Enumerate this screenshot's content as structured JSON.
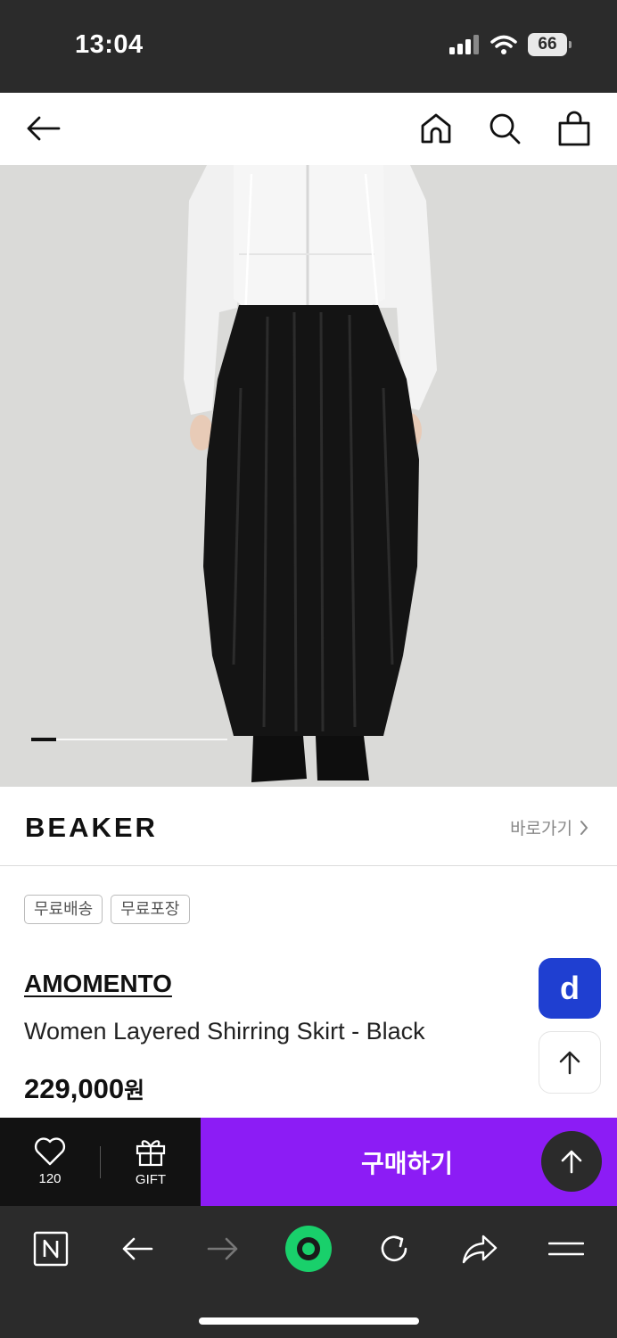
{
  "status_bar": {
    "time": "13:04",
    "battery": "66"
  },
  "top_nav": {
    "icons": [
      "back-arrow-icon",
      "home-icon",
      "search-icon",
      "shopping-bag-icon"
    ]
  },
  "hero": {
    "image": "product-photo"
  },
  "brand_row": {
    "logo": "BEAKER",
    "link_label": "바로가기"
  },
  "product": {
    "badges": [
      "무료배송",
      "무료포장"
    ],
    "brand": "AMOMENTO",
    "name": "Women Layered Shirring Skirt - Black",
    "price": "229,000",
    "price_unit": "원"
  },
  "floating": {
    "d_label": "d"
  },
  "purchase_bar": {
    "like_count": "120",
    "gift_label": "GIFT",
    "buy_label": "구매하기"
  },
  "colors": {
    "buy": "#8c1cf5",
    "d_badge": "#1f3fd1",
    "dark": "#2b2b2b"
  }
}
